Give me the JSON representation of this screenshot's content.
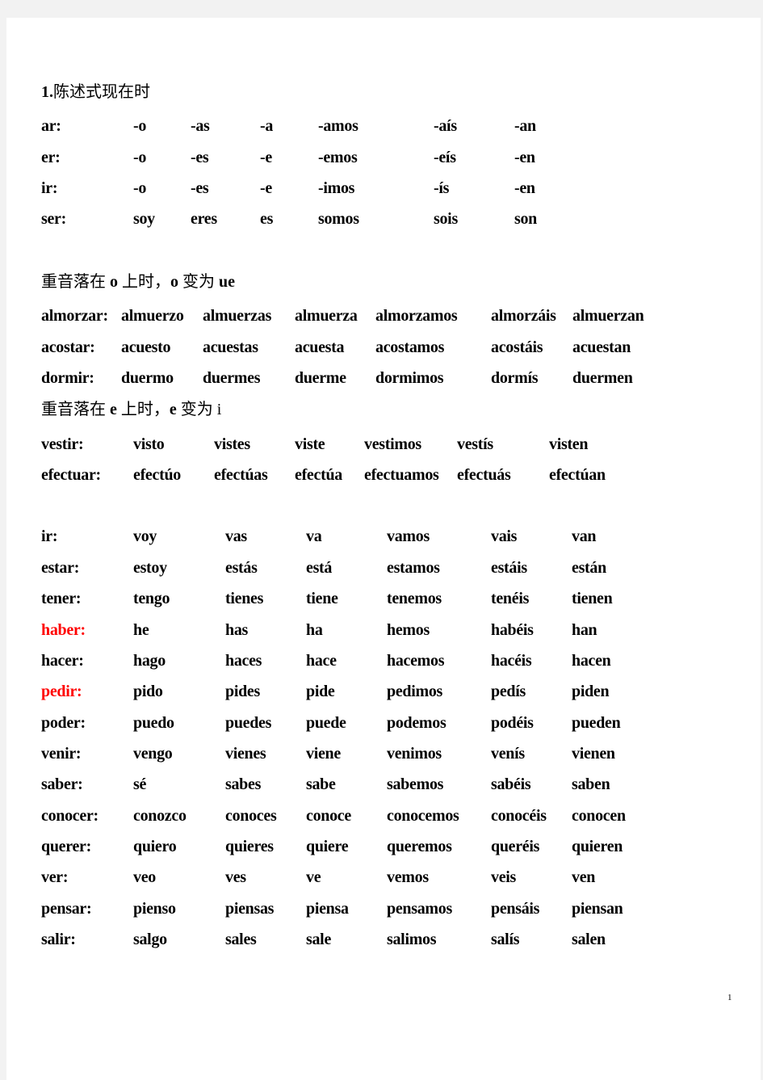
{
  "section1": {
    "title_num": "1.",
    "title_text": "陈述式现在时",
    "rows": [
      [
        "ar:",
        "-o",
        "-as",
        "-a",
        "-amos",
        "-aís",
        "-an"
      ],
      [
        "er:",
        "-o",
        "-es",
        "-e",
        "-emos",
        "-eís",
        "-en"
      ],
      [
        "ir:",
        "-o",
        "-es",
        "-e",
        "-imos",
        "-ís",
        "-en"
      ],
      [
        "ser:",
        "soy",
        "eres",
        "es",
        "somos",
        "sois",
        "son"
      ]
    ]
  },
  "section2": {
    "note_parts": [
      "重音落在 ",
      "o",
      " 上时，",
      "o",
      " 变为 ",
      "ue"
    ],
    "rows": [
      [
        "almorzar:",
        "almuerzo",
        "almuerzas",
        "almuerza",
        "almorzamos",
        "almorzáis",
        "almuerzan"
      ],
      [
        "acostar:",
        "acuesto",
        "acuestas",
        "acuesta",
        "acostamos",
        "acostáis",
        "acuestan"
      ],
      [
        "dormir:",
        "duermo",
        "duermes",
        "duerme",
        "dormimos",
        "dormís",
        "duermen"
      ]
    ]
  },
  "section3": {
    "note_parts": [
      "重音落在 ",
      "e",
      " 上时，",
      "e",
      " 变为 ",
      "i"
    ],
    "rows": [
      [
        "vestir:",
        "visto",
        "vistes",
        "viste",
        "vestimos",
        "vestís",
        "visten"
      ],
      [
        "efectuar:",
        "efectúo",
        "efectúas",
        "efectúa",
        "efectuamos",
        "efectuás",
        "efectúan"
      ]
    ]
  },
  "section4": {
    "highlight_color": "#ff0000",
    "rows": [
      {
        "verb": "ir:",
        "forms": [
          "voy",
          "vas",
          "va",
          "vamos",
          "vais",
          "van"
        ],
        "highlight": false
      },
      {
        "verb": "estar:",
        "forms": [
          "estoy",
          "estás",
          "está",
          "estamos",
          "estáis",
          "están"
        ],
        "highlight": false
      },
      {
        "verb": "tener:",
        "forms": [
          "tengo",
          "tienes",
          "tiene",
          "tenemos",
          "tenéis",
          "tienen"
        ],
        "highlight": false
      },
      {
        "verb": "haber:",
        "forms": [
          "he",
          "has",
          "ha",
          "hemos",
          "habéis",
          "han"
        ],
        "highlight": true
      },
      {
        "verb": "hacer:",
        "forms": [
          "hago",
          "haces",
          "hace",
          "hacemos",
          "hacéis",
          "hacen"
        ],
        "highlight": false
      },
      {
        "verb": "pedir:",
        "forms": [
          "pido",
          "pides",
          "pide",
          "pedimos",
          "pedís",
          "piden"
        ],
        "highlight": true
      },
      {
        "verb": "poder:",
        "forms": [
          "puedo",
          "puedes",
          "puede",
          "podemos",
          "podéis",
          "pueden"
        ],
        "highlight": false
      },
      {
        "verb": "venir:",
        "forms": [
          "vengo",
          "vienes",
          "viene",
          "venimos",
          "venís",
          "vienen"
        ],
        "highlight": false
      },
      {
        "verb": "saber:",
        "forms": [
          "sé",
          "sabes",
          "sabe",
          "sabemos",
          "sabéis",
          "saben"
        ],
        "highlight": false
      },
      {
        "verb": "conocer:",
        "forms": [
          "conozco",
          "conoces",
          "conoce",
          "conocemos",
          "conocéis",
          "conocen"
        ],
        "highlight": false
      },
      {
        "verb": "querer:",
        "forms": [
          "quiero",
          "quieres",
          "quiere",
          "queremos",
          "queréis",
          "quieren"
        ],
        "highlight": false
      },
      {
        "verb": "ver:",
        "forms": [
          "veo",
          "ves",
          "ve",
          "vemos",
          "veis",
          "ven"
        ],
        "highlight": false
      },
      {
        "verb": "pensar:",
        "forms": [
          "pienso",
          "piensas",
          "piensa",
          "pensamos",
          "pensáis",
          "piensan"
        ],
        "highlight": false
      },
      {
        "verb": "salir:",
        "forms": [
          "salgo",
          "sales",
          "sale",
          "salimos",
          "salís",
          "salen"
        ],
        "highlight": false
      }
    ]
  },
  "footer": {
    "page_number": "1"
  }
}
